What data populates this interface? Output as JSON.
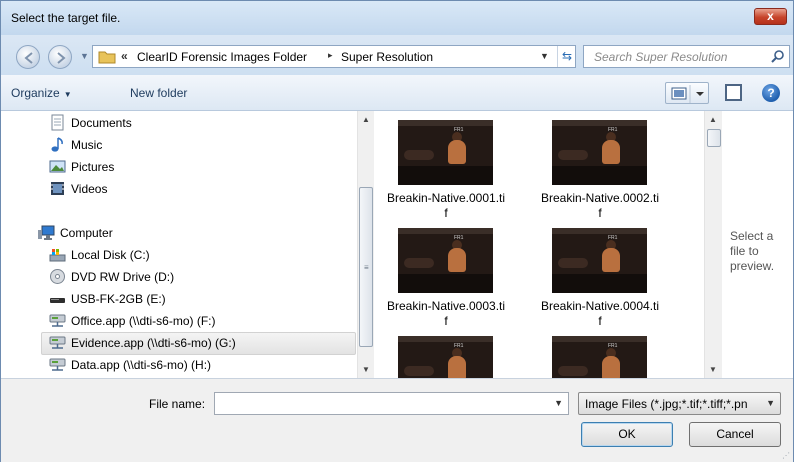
{
  "window": {
    "title": "Select the target file.",
    "close_glyph": "x"
  },
  "address": {
    "prefix": "«",
    "crumbs": [
      "ClearID Forensic Images Folder",
      "Super Resolution"
    ],
    "separator": "▸",
    "search_placeholder": "Search Super Resolution"
  },
  "toolbar": {
    "organize": "Organize",
    "new_folder": "New folder",
    "help_glyph": "?"
  },
  "nav": {
    "items": [
      {
        "label": "Documents",
        "icon": "documents-icon"
      },
      {
        "label": "Music",
        "icon": "music-icon"
      },
      {
        "label": "Pictures",
        "icon": "pictures-icon"
      },
      {
        "label": "Videos",
        "icon": "videos-icon"
      },
      {
        "label": "Computer",
        "icon": "computer-icon"
      },
      {
        "label": "Local Disk (C:)",
        "icon": "local-disk-icon"
      },
      {
        "label": "DVD RW Drive (D:)",
        "icon": "dvd-drive-icon"
      },
      {
        "label": "USB-FK-2GB (E:)",
        "icon": "usb-drive-icon"
      },
      {
        "label": "Office.app (\\\\dti-s6-mo) (F:)",
        "icon": "network-drive-icon"
      },
      {
        "label": "Evidence.app (\\\\dti-s6-mo) (G:)",
        "icon": "network-drive-icon",
        "selected": true
      },
      {
        "label": "Data.app (\\\\dti-s6-mo) (H:)",
        "icon": "network-drive-icon"
      }
    ]
  },
  "files": {
    "items": [
      {
        "name": "Breakin-Native.0001.tif"
      },
      {
        "name": "Breakin-Native.0002.tif"
      },
      {
        "name": "Breakin-Native.0003.tif"
      },
      {
        "name": "Breakin-Native.0004.tif"
      },
      {
        "name": ""
      },
      {
        "name": ""
      }
    ],
    "thumb_frame_label": "FR1"
  },
  "preview": {
    "message": "Select a file to preview."
  },
  "footer": {
    "filename_label": "File name:",
    "filename_value": "",
    "filetype": "Image Files (*.jpg;*.tif;*.tiff;*.pn",
    "ok": "OK",
    "cancel": "Cancel"
  },
  "colors": {
    "accent": "#2a6db5",
    "titlebar": "#c9dcf0",
    "close": "#c7442b"
  }
}
